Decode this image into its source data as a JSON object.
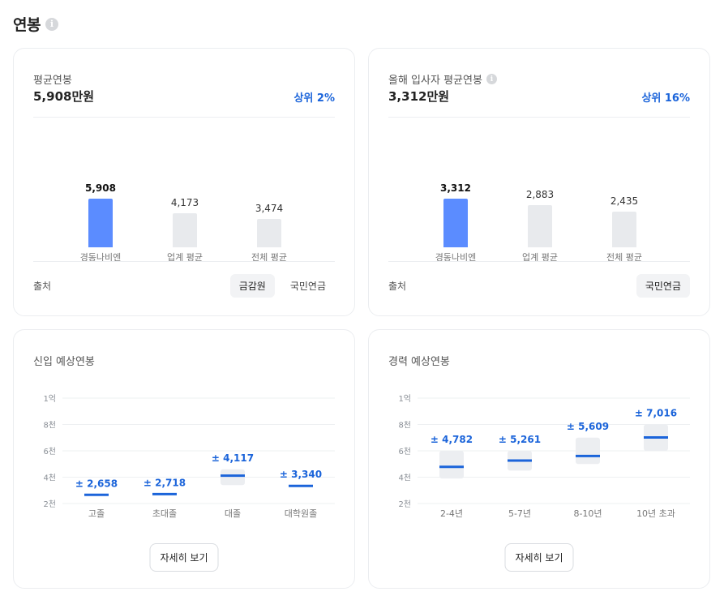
{
  "page": {
    "title": "연봉"
  },
  "avg_salary": {
    "label": "평균연봉",
    "value": "5,908만원",
    "rank": "상위 2%",
    "bars": [
      {
        "value_label": "5,908",
        "value": 5908,
        "category": "경동나비엔",
        "highlight": true
      },
      {
        "value_label": "4,173",
        "value": 4173,
        "category": "업계 평균",
        "highlight": false
      },
      {
        "value_label": "3,474",
        "value": 3474,
        "category": "전체 평균",
        "highlight": false
      }
    ],
    "source_label": "출처",
    "sources": [
      {
        "label": "금감원",
        "active": true
      },
      {
        "label": "국민연금",
        "active": false
      }
    ]
  },
  "new_hire_salary": {
    "label": "올해 입사자 평균연봉",
    "value": "3,312만원",
    "rank": "상위 16%",
    "bars": [
      {
        "value_label": "3,312",
        "value": 3312,
        "category": "경동나비엔",
        "highlight": true
      },
      {
        "value_label": "2,883",
        "value": 2883,
        "category": "업계 평균",
        "highlight": false
      },
      {
        "value_label": "2,435",
        "value": 2435,
        "category": "전체 평균",
        "highlight": false
      }
    ],
    "source_label": "출처",
    "sources": [
      {
        "label": "국민연금",
        "active": true
      }
    ]
  },
  "entry_expected": {
    "label": "신입 예상연봉",
    "y_ticks": [
      "1억",
      "8천",
      "6천",
      "4천",
      "2천"
    ],
    "ylim": [
      2000,
      10000
    ],
    "points": [
      {
        "category": "고졸",
        "label": "± 2,658",
        "value": 2658,
        "low": 2658,
        "high": 2658
      },
      {
        "category": "초대졸",
        "label": "± 2,718",
        "value": 2718,
        "low": 2718,
        "high": 2718
      },
      {
        "category": "대졸",
        "label": "± 4,117",
        "value": 4117,
        "low": 3400,
        "high": 4600
      },
      {
        "category": "대학원졸",
        "label": "± 3,340",
        "value": 3340,
        "low": 3340,
        "high": 3340
      }
    ],
    "detail_button": "자세히 보기"
  },
  "experienced_expected": {
    "label": "경력 예상연봉",
    "y_ticks": [
      "1억",
      "8천",
      "6천",
      "4천",
      "2천"
    ],
    "ylim": [
      2000,
      10000
    ],
    "points": [
      {
        "category": "2-4년",
        "label": "± 4,782",
        "value": 4782,
        "low": 3900,
        "high": 6000
      },
      {
        "category": "5-7년",
        "label": "± 5,261",
        "value": 5261,
        "low": 4500,
        "high": 6000
      },
      {
        "category": "8-10년",
        "label": "± 5,609",
        "value": 5609,
        "low": 5000,
        "high": 7000
      },
      {
        "category": "10년 초과",
        "label": "± 7,016",
        "value": 7016,
        "low": 6000,
        "high": 8000
      }
    ],
    "detail_button": "자세히 보기"
  },
  "colors": {
    "accent": "#1b64da",
    "highlight_bar": "#5b8cff",
    "neutral_bar": "#e8eaed",
    "range_box": "#eceef1"
  }
}
